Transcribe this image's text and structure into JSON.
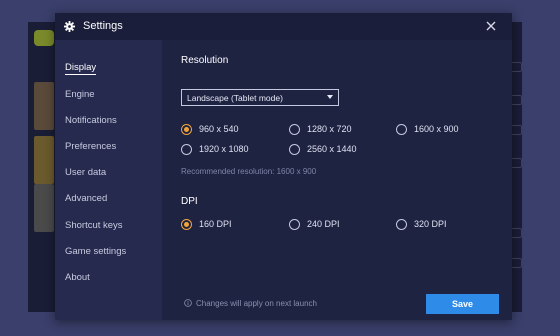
{
  "dialog": {
    "title": "Settings",
    "close_icon": "close-icon",
    "title_icon": "gear-icon"
  },
  "sidebar": {
    "items": [
      {
        "label": "Display",
        "active": true
      },
      {
        "label": "Engine"
      },
      {
        "label": "Notifications"
      },
      {
        "label": "Preferences"
      },
      {
        "label": "User data"
      },
      {
        "label": "Advanced"
      },
      {
        "label": "Shortcut keys"
      },
      {
        "label": "Game settings"
      },
      {
        "label": "About"
      }
    ]
  },
  "display": {
    "resolution": {
      "heading": "Resolution",
      "mode_selected": "Landscape (Tablet mode)",
      "options": [
        {
          "label": "960 x 540",
          "checked": true
        },
        {
          "label": "1280 x 720",
          "checked": false
        },
        {
          "label": "1600 x 900",
          "checked": false
        },
        {
          "label": "1920 x 1080",
          "checked": false
        },
        {
          "label": "2560 x 1440",
          "checked": false
        }
      ],
      "recommended": "Recommended resolution: 1600 x 900"
    },
    "dpi": {
      "heading": "DPI",
      "options": [
        {
          "label": "160 DPI",
          "checked": true
        },
        {
          "label": "240 DPI",
          "checked": false
        },
        {
          "label": "320 DPI",
          "checked": false
        }
      ]
    },
    "footer_note": "Changes will apply on next launch",
    "save_label": "Save"
  },
  "colors": {
    "accent": "#f0a43b",
    "primary_button": "#2f8be8",
    "dialog_bg": "#252a4e",
    "content_bg": "#1f2342"
  }
}
